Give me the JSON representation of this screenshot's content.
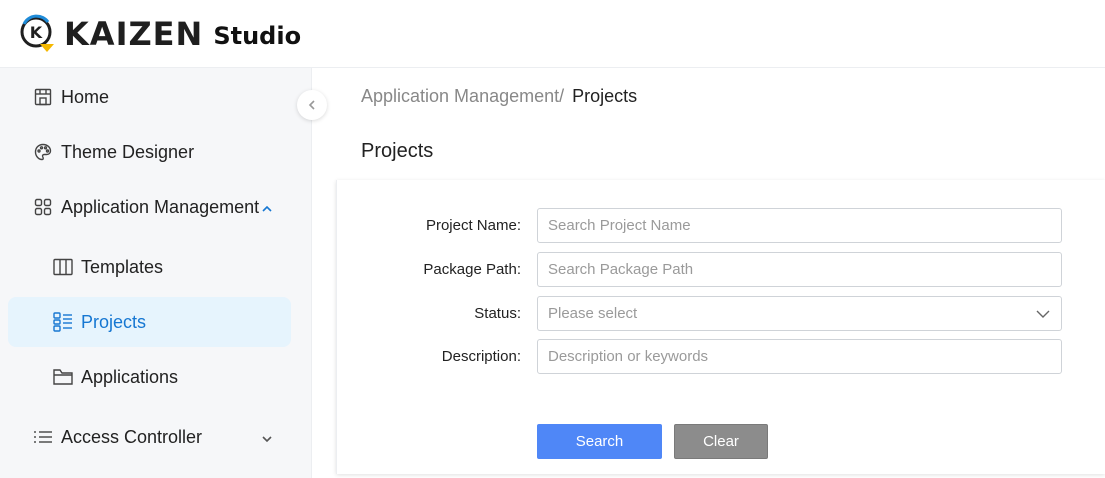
{
  "header": {
    "logo_word": "KAIZEN",
    "logo_studio": "Studio",
    "logo_mark_letter": "K",
    "colors": {
      "logo_dark": "#1f1f1f",
      "logo_accent": "#f5b800",
      "logo_blue": "#1f8bd8"
    }
  },
  "sidebar": {
    "items": [
      {
        "label": "Home",
        "icon": "storefront-icon"
      },
      {
        "label": "Theme Designer",
        "icon": "palette-icon"
      },
      {
        "label": "Application Management",
        "icon": "grid-icon",
        "expanded": true
      },
      {
        "label": "Templates",
        "icon": "columns-icon"
      },
      {
        "label": "Projects",
        "icon": "list-grid-icon",
        "active": true
      },
      {
        "label": "Applications",
        "icon": "folder-icon"
      },
      {
        "label": "Access Controller",
        "icon": "list-icon",
        "expanded": false
      }
    ],
    "active_color": "#1677d2",
    "active_bg": "#e6f4fd"
  },
  "breadcrumb": {
    "parent": "Application Management/",
    "current": "Projects"
  },
  "page_title": "Projects",
  "form": {
    "project_name": {
      "label": "Project Name:",
      "placeholder": "Search Project Name",
      "value": ""
    },
    "package_path": {
      "label": "Package Path:",
      "placeholder": "Search Package Path",
      "value": ""
    },
    "status": {
      "label": "Status:",
      "placeholder": "Please select",
      "value": ""
    },
    "description": {
      "label": "Description:",
      "placeholder": "Description or keywords",
      "value": ""
    }
  },
  "buttons": {
    "search_label": "Search",
    "clear_label": "Clear",
    "search_color": "#4f87f7",
    "clear_color": "#8c8c8c"
  }
}
